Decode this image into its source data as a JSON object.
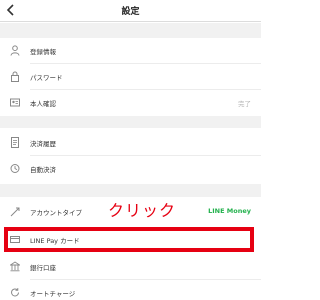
{
  "header": {
    "title": "設定"
  },
  "groups": [
    {
      "items": [
        {
          "label": "登録情報",
          "icon": "person-icon"
        },
        {
          "label": "パスワード",
          "icon": "lock-icon"
        },
        {
          "label": "本人確認",
          "icon": "id-card-icon",
          "value": "完了"
        }
      ]
    },
    {
      "items": [
        {
          "label": "決済履歴",
          "icon": "history-icon"
        },
        {
          "label": "自動決済",
          "icon": "auto-pay-icon"
        }
      ]
    },
    {
      "items": [
        {
          "label": "アカウントタイプ",
          "icon": "account-type-icon",
          "value": "LINE Money"
        },
        {
          "label": "LINE Pay カード",
          "icon": "card-icon"
        },
        {
          "label": "銀行口座",
          "icon": "bank-icon"
        },
        {
          "label": "オートチャージ",
          "icon": "auto-charge-icon"
        }
      ]
    }
  ],
  "annotation": {
    "text": "クリック",
    "color": "#e60012"
  },
  "colors": {
    "accent_green": "#22b14c",
    "highlight_red": "#e60012",
    "section_gap": "#f1f1f1"
  }
}
